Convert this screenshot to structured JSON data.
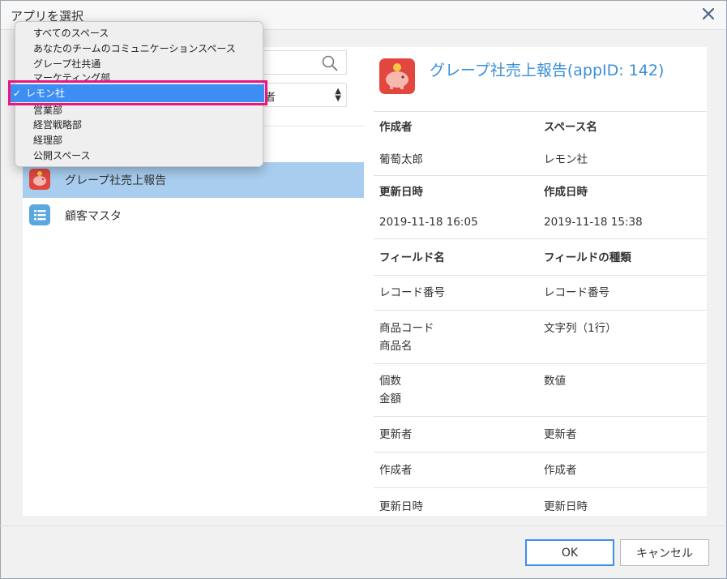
{
  "dialog": {
    "title": "アプリを選択"
  },
  "filter": {
    "selected_partial": "者"
  },
  "space_dropdown": {
    "items": [
      "すべてのスペース",
      "あなたのチームのコミュニケーションスペース",
      "グレープ社共通",
      "マーケティング部",
      "レモン社",
      "営業部",
      "経営戦略部",
      "経理部",
      "公開スペース"
    ],
    "selected": "レモン社",
    "check": "✓"
  },
  "apps": [
    {
      "name": "グレープ社売上報告",
      "icon": "piggy-bank-icon",
      "color": "#e2473f"
    },
    {
      "name": "顧客マスタ",
      "icon": "list-icon",
      "color": "#5aa8e0"
    }
  ],
  "details": {
    "title": "グレープ社売上報告(appID: 142)",
    "creator_label": "作成者",
    "creator": "葡萄太郎",
    "space_label": "スペース名",
    "space": "レモン社",
    "updated_label": "更新日時",
    "updated": "2019-11-18 16:05",
    "created_label": "作成日時",
    "created": "2019-11-18 15:38",
    "field_name_header": "フィールド名",
    "field_type_header": "フィールドの種類",
    "fields": [
      {
        "name": "レコード番号",
        "type": "レコード番号"
      },
      {
        "name": "商品コード",
        "name2": "商品名",
        "type": "文字列（1行）"
      },
      {
        "name": "個数",
        "name2": "金額",
        "type": "数値"
      },
      {
        "name": "更新者",
        "type": "更新者"
      },
      {
        "name": "作成者",
        "type": "作成者"
      },
      {
        "name": "更新日時",
        "type": "更新日時"
      }
    ]
  },
  "buttons": {
    "ok": "OK",
    "cancel": "キャンセル"
  }
}
